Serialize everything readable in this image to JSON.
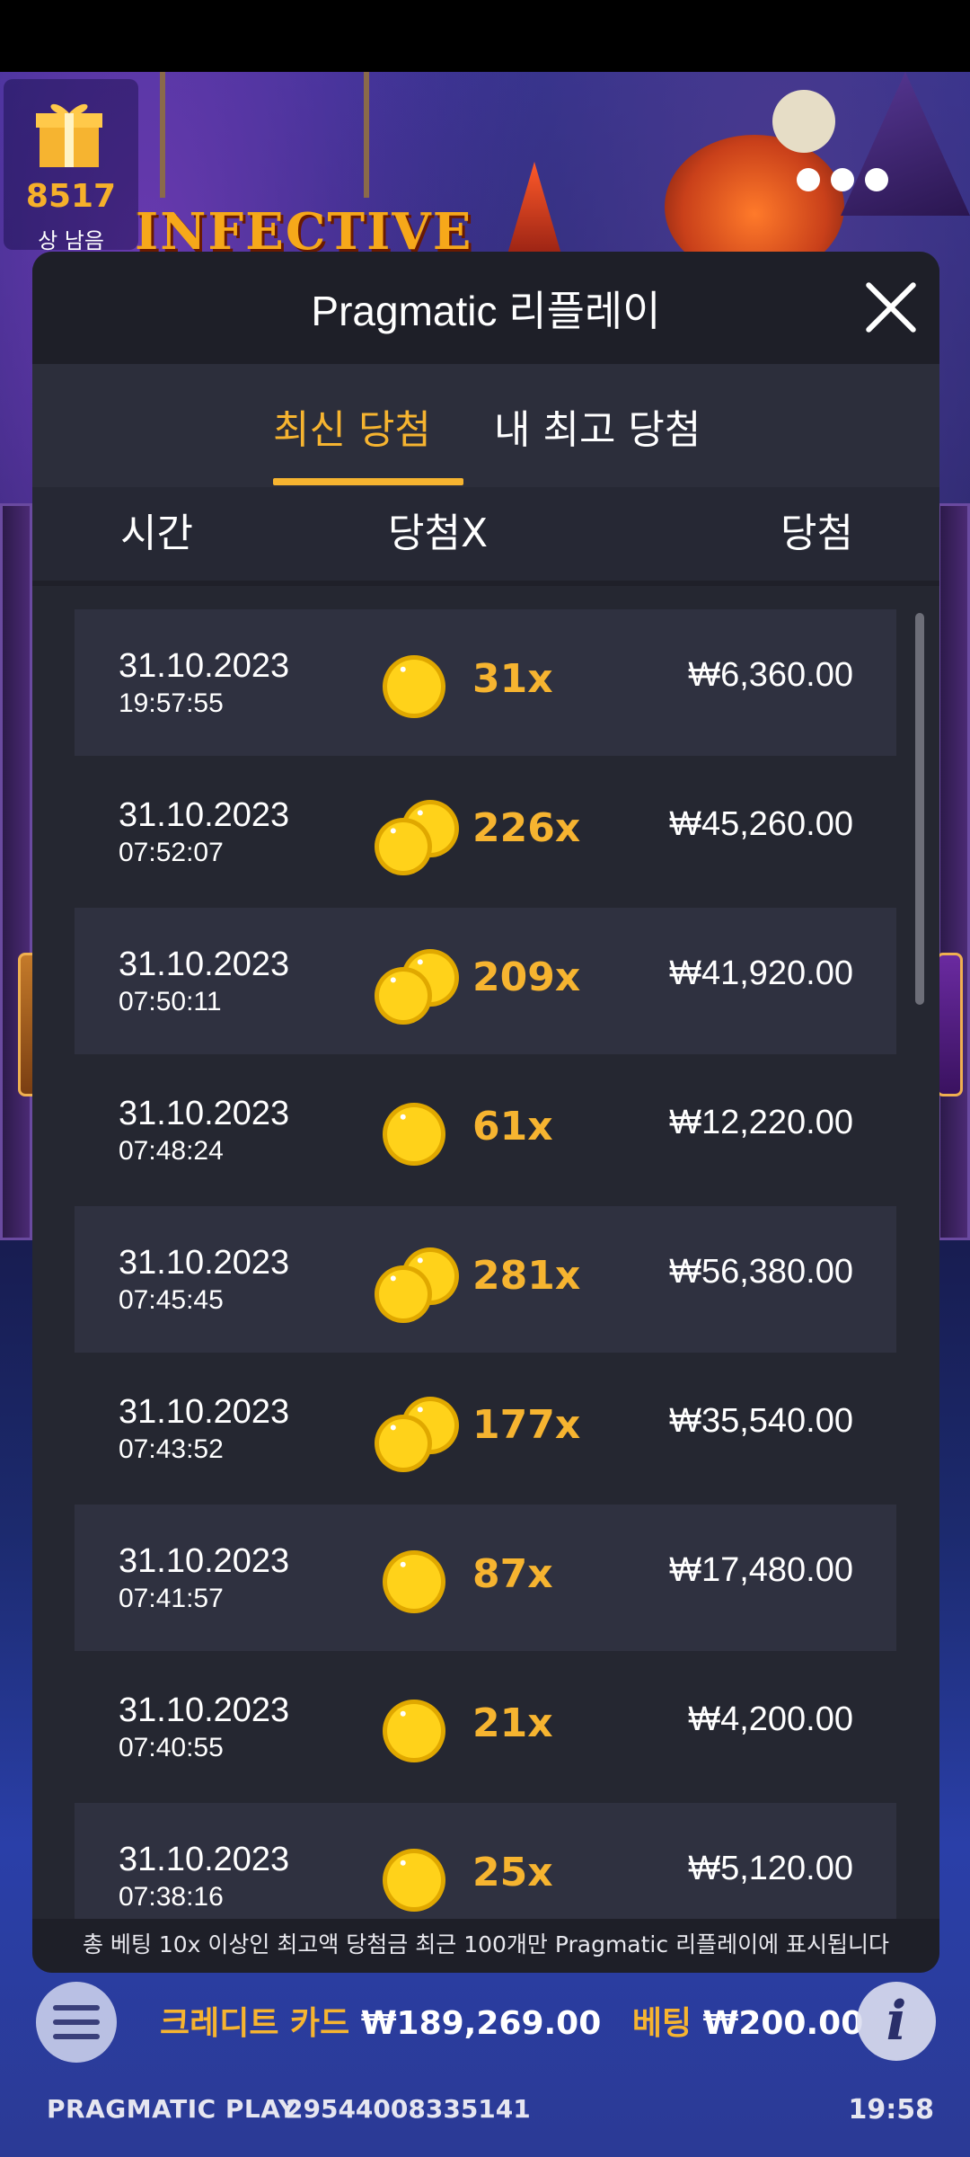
{
  "hud": {
    "gift_count": "8517",
    "gift_label": "상 남음",
    "credit_label": "크레디트 카드",
    "credit_value": "₩189,269.00",
    "bet_label": "베팅",
    "bet_value": "₩200.00",
    "brand": "PRAGMATIC PLAY",
    "session_id": "29544008335141",
    "clock": "19:58"
  },
  "background": {
    "logo_text": "INFECTIVE"
  },
  "modal": {
    "title": "Pragmatic 리플레이",
    "tabs": [
      {
        "label": "최신 당첨",
        "active": true
      },
      {
        "label": "내 최고 당첨",
        "active": false
      }
    ],
    "columns": {
      "time": "시간",
      "multiplier": "당첨X",
      "win": "당첨"
    },
    "rows": [
      {
        "date": "31.10.2023",
        "time": "19:57:55",
        "multiplier": "31x",
        "amount": "₩6,360.00",
        "coins": "single"
      },
      {
        "date": "31.10.2023",
        "time": "07:52:07",
        "multiplier": "226x",
        "amount": "₩45,260.00",
        "coins": "double"
      },
      {
        "date": "31.10.2023",
        "time": "07:50:11",
        "multiplier": "209x",
        "amount": "₩41,920.00",
        "coins": "double"
      },
      {
        "date": "31.10.2023",
        "time": "07:48:24",
        "multiplier": "61x",
        "amount": "₩12,220.00",
        "coins": "single"
      },
      {
        "date": "31.10.2023",
        "time": "07:45:45",
        "multiplier": "281x",
        "amount": "₩56,380.00",
        "coins": "double"
      },
      {
        "date": "31.10.2023",
        "time": "07:43:52",
        "multiplier": "177x",
        "amount": "₩35,540.00",
        "coins": "double"
      },
      {
        "date": "31.10.2023",
        "time": "07:41:57",
        "multiplier": "87x",
        "amount": "₩17,480.00",
        "coins": "single"
      },
      {
        "date": "31.10.2023",
        "time": "07:40:55",
        "multiplier": "21x",
        "amount": "₩4,200.00",
        "coins": "single"
      },
      {
        "date": "31.10.2023",
        "time": "07:38:16",
        "multiplier": "25x",
        "amount": "₩5,120.00",
        "coins": "single"
      }
    ],
    "footer_note": "총 베팅 10x 이상인 최고액 당첨금 최근 100개만 Pragmatic 리플레이에 표시됩니다"
  },
  "colors": {
    "accent": "#f6b430",
    "modal_bg": "#2c2e3b",
    "header_bg": "#1e1f28"
  },
  "icons": {
    "gift": "gift-icon",
    "more": "more-dots-icon",
    "close": "close-icon",
    "coin": "gold-coin-icon",
    "menu": "hamburger-menu-icon",
    "info": "info-icon"
  }
}
